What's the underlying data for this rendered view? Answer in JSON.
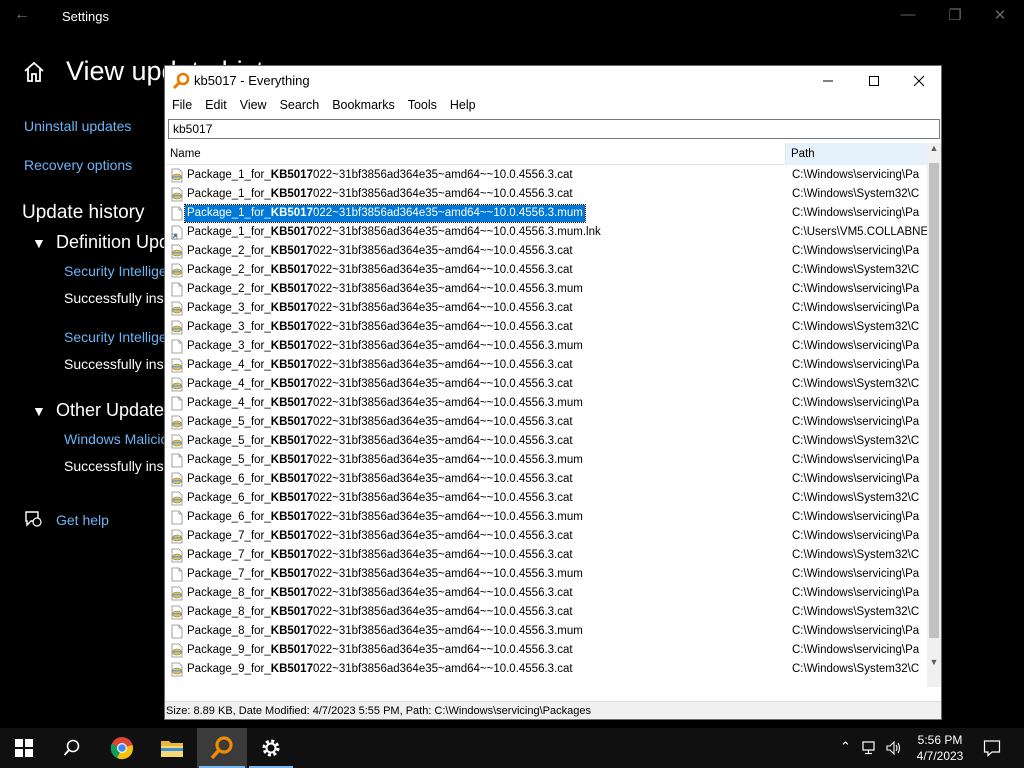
{
  "settings": {
    "app_title": "Settings",
    "page_title": "View update history",
    "uninstall_link": "Uninstall updates",
    "recovery_link": "Recovery options",
    "update_history_heading": "Update history",
    "definition_group": "Definition Updates",
    "def_entry1_link": "Security Intelligence Update for Microsoft Defender Antivirus",
    "def_entry1_status": "Successfully installed",
    "def_entry2_link": "Security Intelligence Update for Microsoft Defender Antivirus",
    "def_entry2_status": "Successfully installed",
    "other_group": "Other Updates",
    "other_entry_link": "Windows Malicious Software Removal Tool",
    "other_entry_status": "Successfully installed",
    "get_help": "Get help"
  },
  "everything": {
    "title": "kb5017 - Everything",
    "menu": [
      "File",
      "Edit",
      "View",
      "Search",
      "Bookmarks",
      "Tools",
      "Help"
    ],
    "search_value": "kb5017",
    "col_name": "Name",
    "col_path": "Path",
    "highlight": "KB5017",
    "rows": [
      {
        "prefix": "Package_1_for_",
        "suffix": "022~31bf3856ad364e35~amd64~~10.0.4556.3.cat",
        "path": "C:\\Windows\\servicing\\Pa",
        "icon": "cat-file-icon"
      },
      {
        "prefix": "Package_1_for_",
        "suffix": "022~31bf3856ad364e35~amd64~~10.0.4556.3.cat",
        "path": "C:\\Windows\\System32\\C",
        "icon": "cat-file-icon"
      },
      {
        "prefix": "Package_1_for_",
        "suffix": "022~31bf3856ad364e35~amd64~~10.0.4556.3.mum",
        "path": "C:\\Windows\\servicing\\Pa",
        "icon": "blank-file-icon",
        "selected": true
      },
      {
        "prefix": "Package_1_for_",
        "suffix": "022~31bf3856ad364e35~amd64~~10.0.4556.3.mum.lnk",
        "path": "C:\\Users\\VM5.COLLABNE",
        "icon": "shortcut-file-icon"
      },
      {
        "prefix": "Package_2_for_",
        "suffix": "022~31bf3856ad364e35~amd64~~10.0.4556.3.cat",
        "path": "C:\\Windows\\servicing\\Pa",
        "icon": "cat-file-icon"
      },
      {
        "prefix": "Package_2_for_",
        "suffix": "022~31bf3856ad364e35~amd64~~10.0.4556.3.cat",
        "path": "C:\\Windows\\System32\\C",
        "icon": "cat-file-icon"
      },
      {
        "prefix": "Package_2_for_",
        "suffix": "022~31bf3856ad364e35~amd64~~10.0.4556.3.mum",
        "path": "C:\\Windows\\servicing\\Pa",
        "icon": "blank-file-icon"
      },
      {
        "prefix": "Package_3_for_",
        "suffix": "022~31bf3856ad364e35~amd64~~10.0.4556.3.cat",
        "path": "C:\\Windows\\servicing\\Pa",
        "icon": "cat-file-icon"
      },
      {
        "prefix": "Package_3_for_",
        "suffix": "022~31bf3856ad364e35~amd64~~10.0.4556.3.cat",
        "path": "C:\\Windows\\System32\\C",
        "icon": "cat-file-icon"
      },
      {
        "prefix": "Package_3_for_",
        "suffix": "022~31bf3856ad364e35~amd64~~10.0.4556.3.mum",
        "path": "C:\\Windows\\servicing\\Pa",
        "icon": "blank-file-icon"
      },
      {
        "prefix": "Package_4_for_",
        "suffix": "022~31bf3856ad364e35~amd64~~10.0.4556.3.cat",
        "path": "C:\\Windows\\servicing\\Pa",
        "icon": "cat-file-icon"
      },
      {
        "prefix": "Package_4_for_",
        "suffix": "022~31bf3856ad364e35~amd64~~10.0.4556.3.cat",
        "path": "C:\\Windows\\System32\\C",
        "icon": "cat-file-icon"
      },
      {
        "prefix": "Package_4_for_",
        "suffix": "022~31bf3856ad364e35~amd64~~10.0.4556.3.mum",
        "path": "C:\\Windows\\servicing\\Pa",
        "icon": "blank-file-icon"
      },
      {
        "prefix": "Package_5_for_",
        "suffix": "022~31bf3856ad364e35~amd64~~10.0.4556.3.cat",
        "path": "C:\\Windows\\servicing\\Pa",
        "icon": "cat-file-icon"
      },
      {
        "prefix": "Package_5_for_",
        "suffix": "022~31bf3856ad364e35~amd64~~10.0.4556.3.cat",
        "path": "C:\\Windows\\System32\\C",
        "icon": "cat-file-icon"
      },
      {
        "prefix": "Package_5_for_",
        "suffix": "022~31bf3856ad364e35~amd64~~10.0.4556.3.mum",
        "path": "C:\\Windows\\servicing\\Pa",
        "icon": "blank-file-icon"
      },
      {
        "prefix": "Package_6_for_",
        "suffix": "022~31bf3856ad364e35~amd64~~10.0.4556.3.cat",
        "path": "C:\\Windows\\servicing\\Pa",
        "icon": "cat-file-icon"
      },
      {
        "prefix": "Package_6_for_",
        "suffix": "022~31bf3856ad364e35~amd64~~10.0.4556.3.cat",
        "path": "C:\\Windows\\System32\\C",
        "icon": "cat-file-icon"
      },
      {
        "prefix": "Package_6_for_",
        "suffix": "022~31bf3856ad364e35~amd64~~10.0.4556.3.mum",
        "path": "C:\\Windows\\servicing\\Pa",
        "icon": "blank-file-icon"
      },
      {
        "prefix": "Package_7_for_",
        "suffix": "022~31bf3856ad364e35~amd64~~10.0.4556.3.cat",
        "path": "C:\\Windows\\servicing\\Pa",
        "icon": "cat-file-icon"
      },
      {
        "prefix": "Package_7_for_",
        "suffix": "022~31bf3856ad364e35~amd64~~10.0.4556.3.cat",
        "path": "C:\\Windows\\System32\\C",
        "icon": "cat-file-icon"
      },
      {
        "prefix": "Package_7_for_",
        "suffix": "022~31bf3856ad364e35~amd64~~10.0.4556.3.mum",
        "path": "C:\\Windows\\servicing\\Pa",
        "icon": "blank-file-icon"
      },
      {
        "prefix": "Package_8_for_",
        "suffix": "022~31bf3856ad364e35~amd64~~10.0.4556.3.cat",
        "path": "C:\\Windows\\servicing\\Pa",
        "icon": "cat-file-icon"
      },
      {
        "prefix": "Package_8_for_",
        "suffix": "022~31bf3856ad364e35~amd64~~10.0.4556.3.cat",
        "path": "C:\\Windows\\System32\\C",
        "icon": "cat-file-icon"
      },
      {
        "prefix": "Package_8_for_",
        "suffix": "022~31bf3856ad364e35~amd64~~10.0.4556.3.mum",
        "path": "C:\\Windows\\servicing\\Pa",
        "icon": "blank-file-icon"
      },
      {
        "prefix": "Package_9_for_",
        "suffix": "022~31bf3856ad364e35~amd64~~10.0.4556.3.cat",
        "path": "C:\\Windows\\servicing\\Pa",
        "icon": "cat-file-icon"
      },
      {
        "prefix": "Package_9_for_",
        "suffix": "022~31bf3856ad364e35~amd64~~10.0.4556.3.cat",
        "path": "C:\\Windows\\System32\\C",
        "icon": "cat-file-icon"
      }
    ],
    "status": "Size: 8.89 KB, Date Modified: 4/7/2023 5:55 PM, Path: C:\\Windows\\servicing\\Packages"
  },
  "taskbar": {
    "time": "5:56 PM",
    "date": "4/7/2023",
    "apps": [
      "start-icon",
      "search-icon",
      "chrome-icon",
      "file-explorer-icon",
      "everything-icon",
      "settings-icon"
    ]
  },
  "colors": {
    "selection": "#0078d7",
    "link": "#6cb4f5",
    "taskbar": "#101010"
  }
}
